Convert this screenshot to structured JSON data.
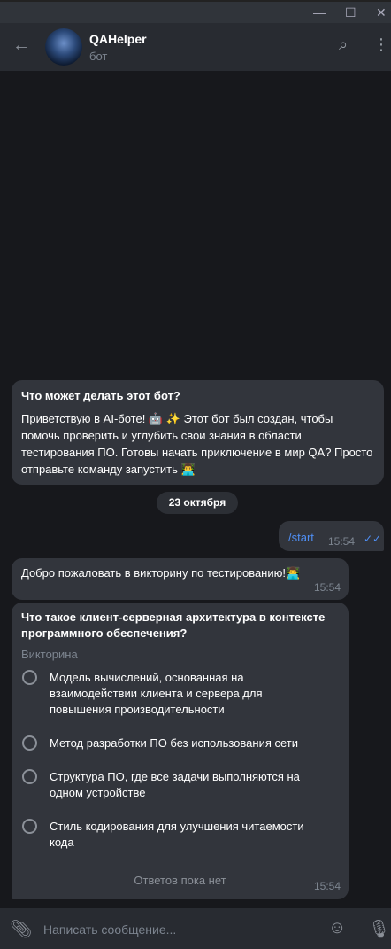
{
  "window": {
    "minimize": "—",
    "maximize": "☐",
    "close": "✕"
  },
  "header": {
    "title": "QAHelper",
    "subtitle": "бот"
  },
  "intro": {
    "title": "Что может делать этот бот?",
    "text": "Приветствую  в  AI-боте! 🤖 ✨ Этот бот был создан, чтобы помочь  проверить и углубить свои знания в области тестирования ПО. Готовы начать  приключение в мир QA? Просто отправьте команду запустить 👨‍💻"
  },
  "date_separator": "23 октября",
  "messages": [
    {
      "text": "/start",
      "time": "15:54",
      "outgoing": true,
      "read": true
    },
    {
      "text": "Добро пожаловать в викторину по тестированию!👨‍💻",
      "time": "15:54"
    }
  ],
  "quiz": {
    "question": "Что такое клиент-серверная архитектура в контексте программного обеспечения?",
    "type": "Викторина",
    "options": [
      "Модель вычислений, основанная на взаимодействии клиента и сервера для повышения производительности",
      "Метод разработки ПО без использования сети",
      "Структура ПО, где все задачи выполняются на одном устройстве",
      "Стиль кодирования для улучшения читаемости кода"
    ],
    "no_answers": "Ответов пока нет",
    "time": "15:54"
  },
  "composer": {
    "placeholder": "Написать сообщение..."
  },
  "colors": {
    "accent": "#4f8ff5",
    "bubble": "#32353c",
    "background": "#17181c"
  }
}
